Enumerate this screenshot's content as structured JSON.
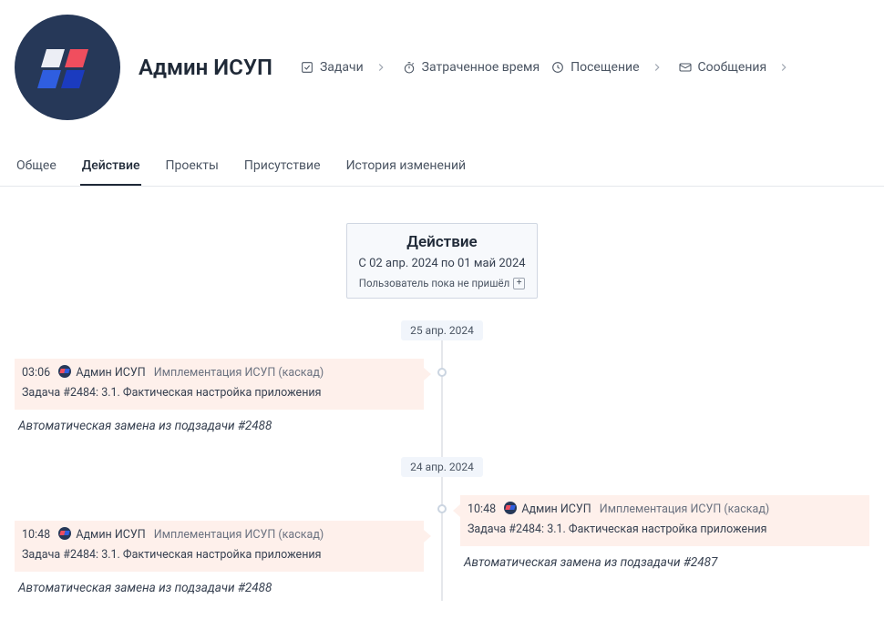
{
  "header": {
    "title": "Админ ИСУП",
    "nav": [
      {
        "label": "Задачи"
      },
      {
        "label": "Затраченное время"
      },
      {
        "label": "Посещение"
      },
      {
        "label": "Сообщения"
      }
    ]
  },
  "tabs": [
    {
      "label": "Общее",
      "active": false
    },
    {
      "label": "Действие",
      "active": true
    },
    {
      "label": "Проекты",
      "active": false
    },
    {
      "label": "Присутствие",
      "active": false
    },
    {
      "label": "История изменений",
      "active": false
    }
  ],
  "summary": {
    "title": "Действие",
    "range": "С 02 апр. 2024 по 01 май 2024",
    "note": "Пользователь пока не пришёл"
  },
  "dates": {
    "d0": "25 апр. 2024",
    "d1": "24 апр. 2024"
  },
  "entries": {
    "e0": {
      "time": "03:06",
      "user": "Админ ИСУП",
      "project": "Имплементация ИСУП (каскад)",
      "task": "Задача #2484: 3.1. Фактическая настройка приложения",
      "body": "Автоматическая замена из подзадачи #2488"
    },
    "e1": {
      "time": "10:48",
      "user": "Админ ИСУП",
      "project": "Имплементация ИСУП (каскад)",
      "task": "Задача #2484: 3.1. Фактическая настройка приложения",
      "body": "Автоматическая замена из подзадачи #2488"
    },
    "e2": {
      "time": "10:48",
      "user": "Админ ИСУП",
      "project": "Имплементация ИСУП (каскад)",
      "task": "Задача #2484: 3.1. Фактическая настройка приложения",
      "body": "Автоматическая замена из подзадачи #2487"
    }
  }
}
